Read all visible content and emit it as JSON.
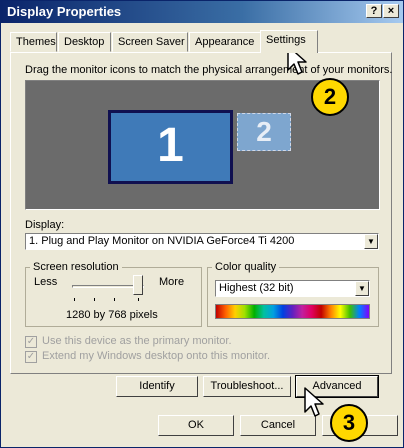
{
  "window": {
    "title": "Display Properties",
    "help_btn": "?",
    "close_btn": "×"
  },
  "tabs": [
    {
      "label": "Themes"
    },
    {
      "label": "Desktop"
    },
    {
      "label": "Screen Saver"
    },
    {
      "label": "Appearance"
    },
    {
      "label": "Settings",
      "active": true
    }
  ],
  "settings": {
    "instruction": "Drag the monitor icons to match the physical arrangement of your monitors.",
    "monitor1": "1",
    "monitor2": "2",
    "display_label": "Display:",
    "display_value": "1. Plug and Play Monitor on NVIDIA GeForce4 Ti 4200",
    "resolution": {
      "group_label": "Screen resolution",
      "less": "Less",
      "more": "More",
      "value_text": "1280 by 768 pixels",
      "slider_level": 0.85
    },
    "color_quality": {
      "group_label": "Color quality",
      "value": "Highest (32 bit)"
    },
    "primary_checkbox": "Use this device as the primary monitor.",
    "extend_checkbox": "Extend my Windows desktop onto this monitor.",
    "buttons": {
      "identify": "Identify",
      "troubleshoot": "Troubleshoot...",
      "advanced": "Advanced"
    }
  },
  "footer": {
    "ok": "OK",
    "cancel": "Cancel"
  },
  "callouts": {
    "step2": "2",
    "step3": "3"
  },
  "colors": {
    "titlebar": "#0a246a",
    "monitor_blue": "#3f7ab8",
    "callout": "#ffd800"
  }
}
